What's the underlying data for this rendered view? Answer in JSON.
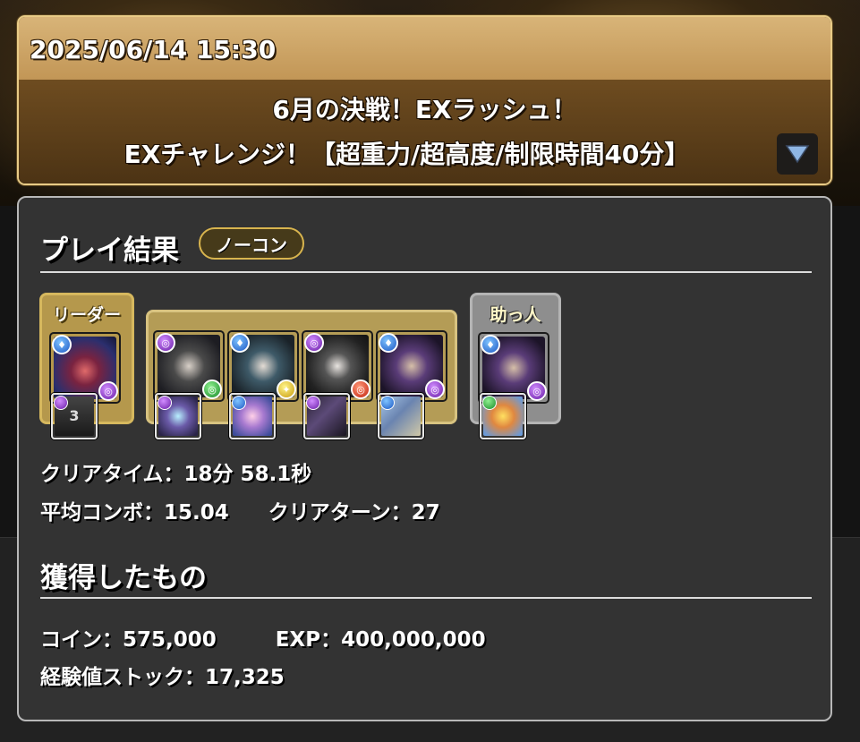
{
  "header": {
    "datetime": "2025/06/14 15:30",
    "dungeon_title": "6月の決戦！EXラッシュ！",
    "floor_title": "EXチャレンジ！【超重力/超高度/制限時間40分】",
    "expand_icon": "triangle-down-icon"
  },
  "result": {
    "title": "プレイ結果",
    "badge": "ノーコン",
    "leader_label": "リーダー",
    "helper_label": "助っ人",
    "team": [
      {
        "role": "leader",
        "attrs": [
          "water",
          "dark"
        ],
        "assist_attr": "dark",
        "assist_text": "3"
      },
      {
        "role": "sub",
        "attrs": [
          "dark",
          "wood"
        ],
        "assist_attr": "dark"
      },
      {
        "role": "sub",
        "attrs": [
          "water",
          "light"
        ],
        "assist_attr": "water"
      },
      {
        "role": "sub",
        "attrs": [
          "dark",
          "fire"
        ],
        "assist_attr": "dark"
      },
      {
        "role": "sub",
        "attrs": [
          "water",
          "dark"
        ],
        "assist_attr": "water"
      },
      {
        "role": "helper",
        "attrs": [
          "water",
          "dark"
        ],
        "assist_attr": "wood"
      }
    ],
    "clear_time_label": "クリアタイム：",
    "clear_time_value": "18分 58.1秒",
    "avg_combo_label": "平均コンボ：",
    "avg_combo_value": "15.04",
    "clear_turn_label": "クリアターン：",
    "clear_turn_value": "27"
  },
  "rewards": {
    "title": "獲得したもの",
    "coin_label": "コイン：",
    "coin_value": "575,000",
    "exp_label": "EXP：",
    "exp_value": "400,000,000",
    "exp_stock_label": "経験値ストック：",
    "exp_stock_value": "17,325"
  },
  "colors": {
    "header_border": "#e8cb86",
    "date_bar": "#c9a060",
    "panel_bg": "#333333",
    "badge_border": "#d8b44e"
  }
}
